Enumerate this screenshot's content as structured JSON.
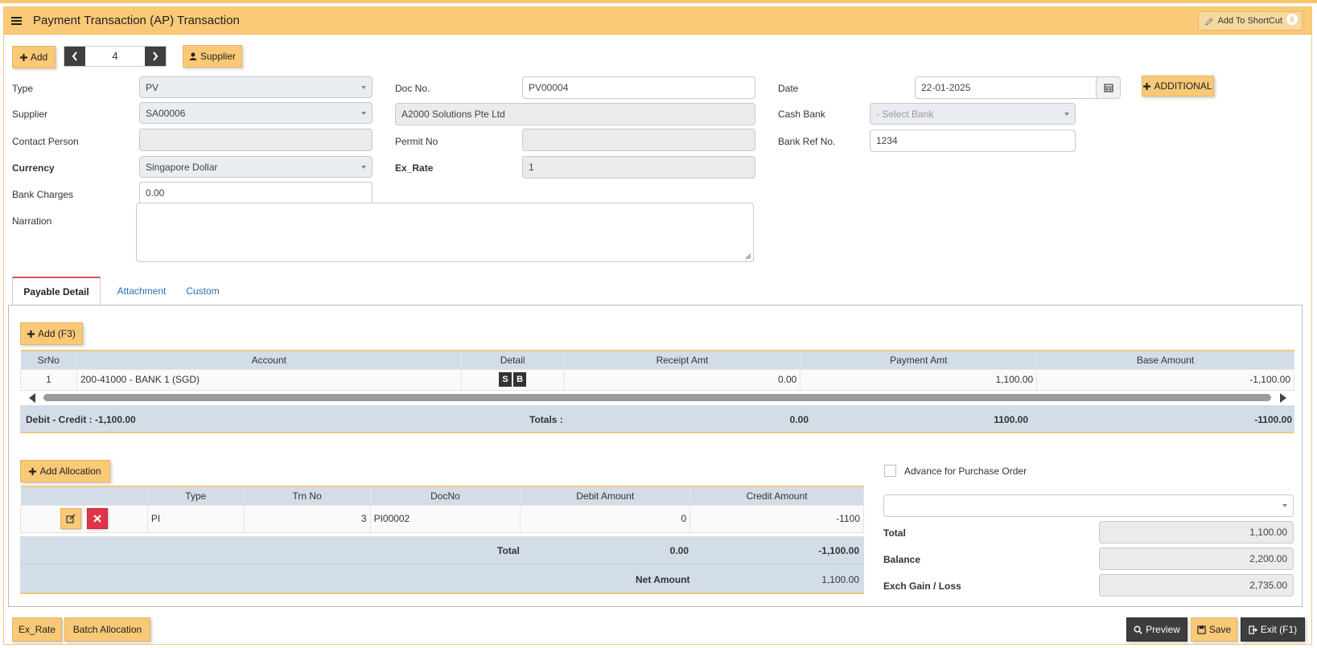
{
  "window": {
    "title": "Payment Transaction (AP) Transaction",
    "shortcut_label": "Add To ShortCut",
    "shortcut_badge": "6"
  },
  "toolbar": {
    "add_label": "Add",
    "record_number": "4",
    "supplier_label": "Supplier",
    "additional_label": "ADDITIONAL"
  },
  "form": {
    "type_label": "Type",
    "type_value": "PV",
    "docno_label": "Doc No.",
    "docno_value": "PV00004",
    "date_label": "Date",
    "date_value": "22-01-2025",
    "supplier_label": "Supplier",
    "supplier_code": "SA00006",
    "supplier_name": "A2000 Solutions Pte Ltd",
    "cashbank_label": "Cash Bank",
    "cashbank_placeholder": "- Select Bank",
    "contact_label": "Contact Person",
    "contact_value": "",
    "permit_label": "Permit No",
    "permit_value": "",
    "bankref_label": "Bank Ref No.",
    "bankref_value": "1234",
    "currency_label": "Currency",
    "currency_value": "Singapore Dollar",
    "exrate_label": "Ex_Rate",
    "exrate_value": "1",
    "bankcharges_label": "Bank Charges",
    "bankcharges_value": "0.00",
    "narration_label": "Narration",
    "narration_value": ""
  },
  "tabs": [
    {
      "label": "Payable Detail",
      "active": true
    },
    {
      "label": "Attachment",
      "active": false
    },
    {
      "label": "Custom",
      "active": false
    }
  ],
  "payable": {
    "add_label": "Add (F3)",
    "columns": [
      "SrNo",
      "Account",
      "Detail",
      "Receipt Amt",
      "Payment Amt",
      "Base Amount"
    ],
    "rows": [
      {
        "srno": "1",
        "account": "200-41000 - BANK 1 (SGD)",
        "detail_s": "S",
        "detail_b": "B",
        "receipt": "0.00",
        "payment": "1,100.00",
        "base": "-1,100.00"
      }
    ],
    "debit_credit": "Debit - Credit : -1,100.00",
    "totals_label": "Totals :",
    "total_receipt": "0.00",
    "total_payment": "1100.00",
    "total_base": "-1100.00"
  },
  "allocation": {
    "add_label": "Add Allocation",
    "columns": [
      "",
      "Type",
      "Trn No",
      "DocNo",
      "Debit Amount",
      "Credit Amount"
    ],
    "rows": [
      {
        "type": "PI",
        "trn_no": "3",
        "docno": "PI00002",
        "debit": "0",
        "credit": "-1100"
      }
    ],
    "total_label": "Total",
    "total_debit": "0.00",
    "total_credit": "-1,100.00",
    "net_label": "Net Amount",
    "net_value": "1,100.00"
  },
  "summary": {
    "advance_label": "Advance for Purchase Order",
    "po_select_value": "",
    "total_label": "Total",
    "total_value": "1,100.00",
    "balance_label": "Balance",
    "balance_value": "2,200.00",
    "exch_label": "Exch Gain / Loss",
    "exch_value": "2,735.00"
  },
  "footer": {
    "exrate_label": "Ex_Rate",
    "batch_label": "Batch Allocation",
    "preview_label": "Preview",
    "save_label": "Save",
    "exit_label": "Exit (F1)"
  },
  "colors": {
    "accent": "#f9c977",
    "header_bg": "#d3dde8",
    "dark_button": "#3d3d3d",
    "delete_red": "#e0344a",
    "link": "#2a6fb5",
    "active_tab_border": "#e05050"
  }
}
